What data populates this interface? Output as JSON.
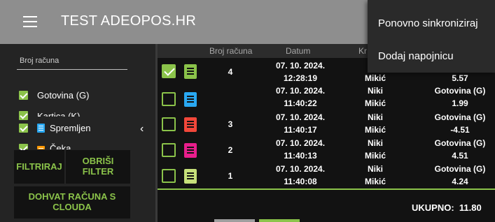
{
  "appbar": {
    "title": "TEST ADEOPOS.HR",
    "menu_icon": "hamburger-menu-icon"
  },
  "overflow_menu": {
    "items": [
      "Ponovno sinkroniziraj",
      "Dodaj napojnicu"
    ]
  },
  "filters": {
    "search_placeholder": "Broj računa",
    "payment_types": [
      "Gotovina (G)",
      "Kartica (K)"
    ],
    "statuses": [
      "Spremljen",
      "Čeka"
    ],
    "collapse_glyph": "‹"
  },
  "buttons": {
    "filter": "FILTRIRAJ",
    "clear_filter": "OBRIŠI FILTER",
    "fetch_cloud": "DOHVAT RAČUNA S CLOUDA"
  },
  "table": {
    "headers": [
      "Broj računa",
      "Datum",
      "Kr"
    ],
    "rows": [
      {
        "number": "4",
        "date": "07. 10. 2024.",
        "time": "12:28:19",
        "cashier_first": "",
        "cashier_last": "Mikić",
        "payment": "",
        "amount": "5.57",
        "checked": true,
        "color": "#8bc34a"
      },
      {
        "number": "",
        "date": "07. 10. 2024.",
        "time": "11:40:22",
        "cashier_first": "Niki",
        "cashier_last": "Mikić",
        "payment": "Gotovina (G)",
        "amount": "1.99",
        "checked": false,
        "color": "#29a8f2"
      },
      {
        "number": "3",
        "date": "07. 10. 2024.",
        "time": "11:40:17",
        "cashier_first": "Niki",
        "cashier_last": "Mikić",
        "payment": "Gotovina (G)",
        "amount": "-4.51",
        "checked": false,
        "color": "#f2473a"
      },
      {
        "number": "2",
        "date": "07. 10. 2024.",
        "time": "11:40:13",
        "cashier_first": "Niki",
        "cashier_last": "Mikić",
        "payment": "Gotovina (G)",
        "amount": "4.51",
        "checked": false,
        "color": "#e91e8c"
      },
      {
        "number": "1",
        "date": "07. 10. 2024.",
        "time": "11:40:08",
        "cashier_first": "Niki",
        "cashier_last": "Mikić",
        "payment": "Gotovina (G)",
        "amount": "4.24",
        "checked": false,
        "color": "#c6e07a"
      }
    ],
    "total_label": "UKUPNO:",
    "total_value": "11.80"
  },
  "colors": {
    "accent": "#8bc34a",
    "appbar": "#8e8e8e",
    "menu_bg": "#2a2a2a"
  }
}
